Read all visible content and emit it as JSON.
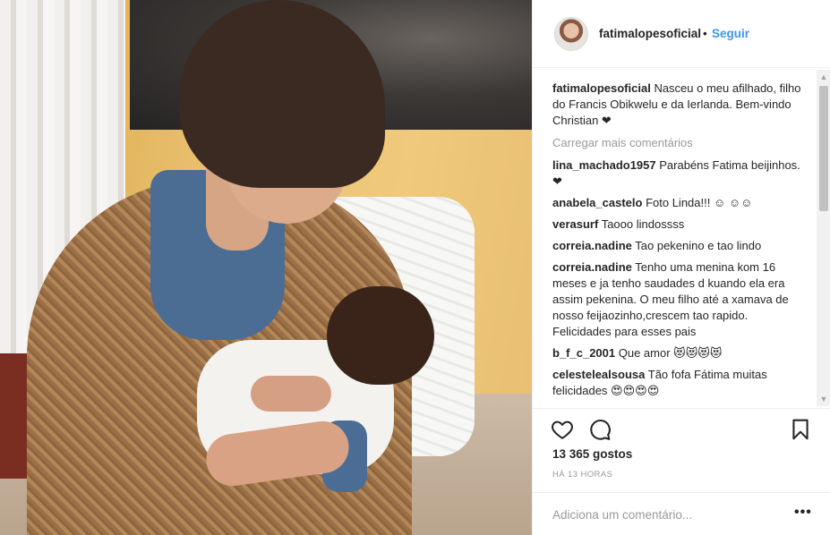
{
  "post": {
    "photo_alt": "",
    "username": "fatimalopesoficial",
    "dot": "•",
    "follow_label": "Seguir"
  },
  "caption": {
    "user": "fatimalopesoficial",
    "text": "Nasceu o meu afilhado, filho do Francis Obikwelu e da Ierlanda. Bem-vindo Christian ❤"
  },
  "load_more": "Carregar mais comentários",
  "comments": [
    {
      "user": "lina_machado1957",
      "text": "Parabéns Fatima beijinhos.❤"
    },
    {
      "user": "anabela_castelo",
      "text": "Foto Linda!!! ☺ ☺☺"
    },
    {
      "user": "verasurf",
      "text": "Taooo lindossss"
    },
    {
      "user": "correia.nadine",
      "text": "Tao pekenino e tao lindo"
    },
    {
      "user": "correia.nadine",
      "text": "Tenho uma menina kom 16 meses e ja tenho saudades d kuando ela era assim pekenina. O meu filho até a xamava de nosso feijaozinho,crescem tao rapido. Felicidades para esses pais"
    },
    {
      "user": "b_f_c_2001",
      "text": "Que amor 😻😻😻😻"
    },
    {
      "user": "celestelealsousa",
      "text": "Tão fofa Fátima muitas felicidades 😍😍😍😍"
    }
  ],
  "likes": "13 365 gostos",
  "time": "HÁ 13 HORAS",
  "add_comment_placeholder": "Adiciona um comentário...",
  "more_label": "•••",
  "icons": {
    "like": "heart-icon",
    "comment": "comment-icon",
    "save": "bookmark-icon"
  },
  "colors": {
    "link_blue": "#3897f0",
    "text": "#262626",
    "muted": "#999999",
    "divider": "#efefef"
  }
}
